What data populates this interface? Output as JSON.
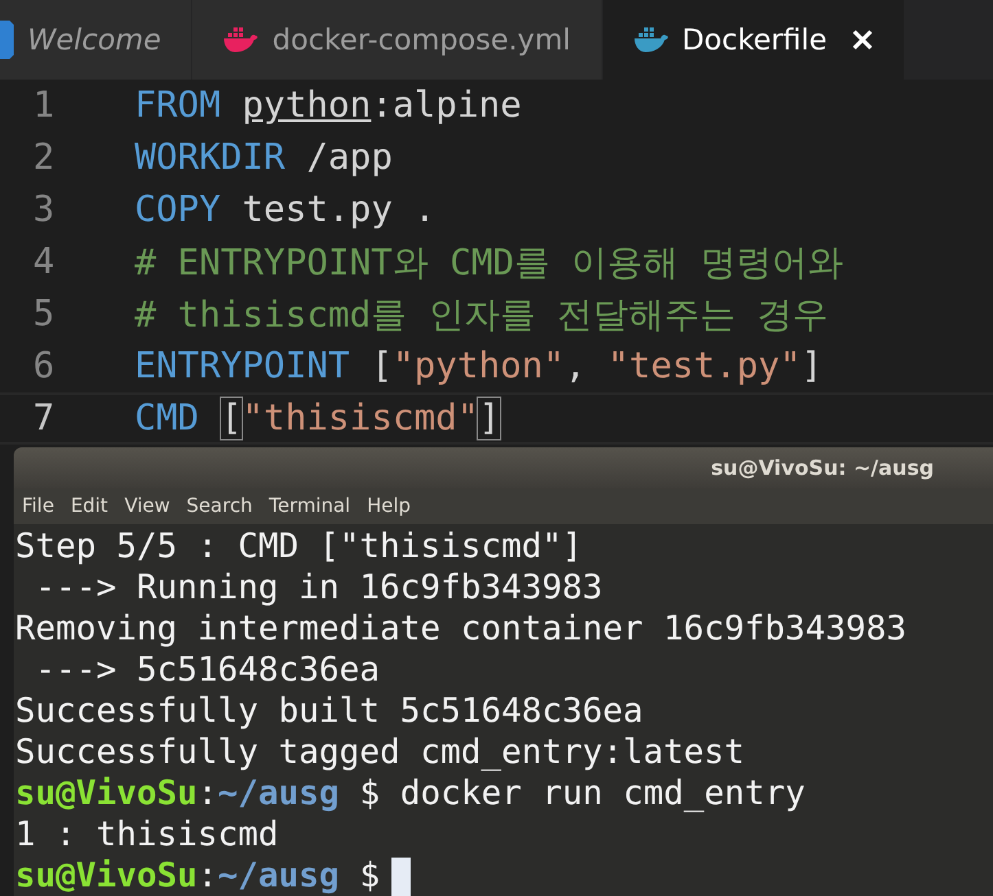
{
  "tabs": [
    {
      "label": "Welcome",
      "kind": "vscode",
      "color": "#2f80d1",
      "preview": true,
      "selected": false
    },
    {
      "label": "docker-compose.yml",
      "kind": "docker",
      "color": "#e8215f",
      "preview": false,
      "selected": false
    },
    {
      "label": "Dockerfile",
      "kind": "docker",
      "color": "#3a9bc4",
      "preview": false,
      "selected": true
    }
  ],
  "code": [
    {
      "number": "1",
      "current": false,
      "tokens": [
        {
          "text": "FROM ",
          "kind": "keyword"
        },
        {
          "text": "python",
          "kind": "link"
        },
        {
          "text": ":alpine",
          "kind": "plain"
        }
      ]
    },
    {
      "number": "2",
      "current": false,
      "tokens": [
        {
          "text": "WORKDIR",
          "kind": "keyword"
        },
        {
          "text": " /app",
          "kind": "plain"
        }
      ]
    },
    {
      "number": "3",
      "current": false,
      "tokens": [
        {
          "text": "COPY",
          "kind": "keyword"
        },
        {
          "text": " test.py .",
          "kind": "plain"
        }
      ]
    },
    {
      "number": "4",
      "current": false,
      "tokens": [
        {
          "text": "# ENTRYPOINT와 CMD를 이용해 명령어와",
          "kind": "comment"
        }
      ]
    },
    {
      "number": "5",
      "current": false,
      "tokens": [
        {
          "text": "# thisiscmd를 인자를 전달해주는 경우",
          "kind": "comment"
        }
      ]
    },
    {
      "number": "6",
      "current": false,
      "tokens": [
        {
          "text": "ENTRYPOINT",
          "kind": "keyword"
        },
        {
          "text": " [",
          "kind": "plain"
        },
        {
          "text": "\"python\"",
          "kind": "string"
        },
        {
          "text": ", ",
          "kind": "plain"
        },
        {
          "text": "\"test.py\"",
          "kind": "string"
        },
        {
          "text": "]",
          "kind": "plain"
        }
      ]
    },
    {
      "number": "7",
      "current": true,
      "tokens": [
        {
          "text": "CMD ",
          "kind": "keyword"
        },
        {
          "text": "[",
          "kind": "bracket"
        },
        {
          "text": "\"thisiscmd\"",
          "kind": "string"
        },
        {
          "text": "]",
          "kind": "bracket"
        }
      ]
    }
  ],
  "terminal": {
    "title": "su@VivoSu: ~/ausg",
    "menu": [
      "File",
      "Edit",
      "View",
      "Search",
      "Terminal",
      "Help"
    ],
    "lines": [
      {
        "kind": "output",
        "text": "Step 5/5 : CMD [\"thisiscmd\"]"
      },
      {
        "kind": "output",
        "text": " ---> Running in 16c9fb343983"
      },
      {
        "kind": "output",
        "text": "Removing intermediate container 16c9fb343983"
      },
      {
        "kind": "output",
        "text": " ---> 5c51648c36ea"
      },
      {
        "kind": "output",
        "text": "Successfully built 5c51648c36ea"
      },
      {
        "kind": "output",
        "text": "Successfully tagged cmd_entry:latest"
      },
      {
        "kind": "prompt",
        "user": "su@VivoSu",
        "separator": ":",
        "path": "~/ausg",
        "symbol": "$",
        "command": "docker run cmd_entry"
      },
      {
        "kind": "output",
        "text": "1 : thisiscmd"
      },
      {
        "kind": "prompt",
        "user": "su@VivoSu",
        "separator": ":",
        "path": "~/ausg",
        "symbol": "$",
        "cursor": true
      }
    ]
  }
}
